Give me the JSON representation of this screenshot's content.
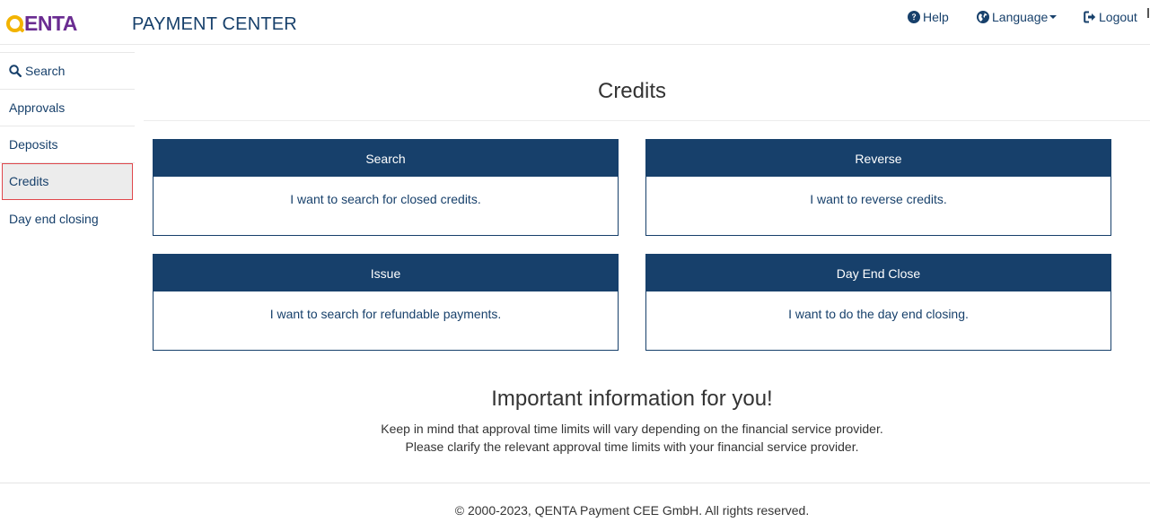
{
  "brand": {
    "logo_text": "QENTA",
    "logo_suffix": "ENTA",
    "app_title": "PAYMENT CENTER",
    "colors": {
      "primary": "#17406b",
      "logo_purple": "#6a2c91",
      "logo_yellow": "#f2b300",
      "active_outline": "#e0474c"
    }
  },
  "topnav": {
    "help": {
      "label": "Help",
      "icon": "question-circle-icon"
    },
    "language": {
      "label": "Language",
      "icon": "globe-icon"
    },
    "logout": {
      "label": "Logout",
      "icon": "sign-out-icon"
    }
  },
  "sidebar": {
    "items": [
      {
        "label": "Search",
        "icon": "search-icon",
        "active": false
      },
      {
        "label": "Approvals",
        "active": false
      },
      {
        "label": "Deposits",
        "active": false
      },
      {
        "label": "Credits",
        "active": true
      },
      {
        "label": "Day end closing",
        "active": false
      }
    ]
  },
  "main": {
    "title": "Credits",
    "cards": [
      {
        "title": "Search",
        "description": "I want to search for closed credits."
      },
      {
        "title": "Reverse",
        "description": "I want to reverse credits."
      },
      {
        "title": "Issue",
        "description": "I want to search for refundable payments."
      },
      {
        "title": "Day End Close",
        "description": "I want to do the day end closing."
      }
    ],
    "info": {
      "title": "Important information for you!",
      "line1": "Keep in mind that approval time limits will vary depending on the financial service provider.",
      "line2": "Please clarify the relevant approval time limits with your financial service provider."
    }
  },
  "footer": {
    "copyright": "© 2000-2023, QENTA Payment CEE GmbH. All rights reserved."
  }
}
